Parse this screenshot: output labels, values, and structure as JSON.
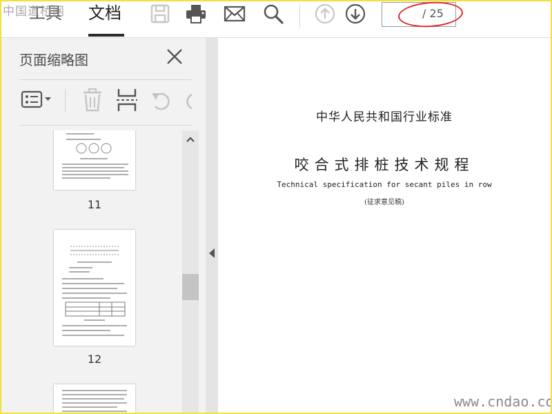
{
  "watermark_logo": "中国道桥网",
  "toolbar": {
    "tab_tools": "工具",
    "tab_document": "文档",
    "icons": [
      "save-icon",
      "print-icon",
      "mail-icon",
      "search-icon",
      "page-up-icon",
      "page-down-icon"
    ],
    "page_input_value": "",
    "page_total": "/ 25"
  },
  "sidebar": {
    "title": "页面缩略图",
    "tools": [
      "thumbnail-options-icon",
      "delete-icon",
      "crop-icon",
      "rotate-left-icon",
      "rotate-right-icon"
    ],
    "thumbnails": [
      {
        "label": "11"
      },
      {
        "label": "12"
      }
    ]
  },
  "document": {
    "line1": "中华人民共和国行业标准",
    "title": "咬合式排桩技术规程",
    "english_title": "Technical specification for secant piles in row",
    "note": "(征求意见稿)"
  },
  "site_watermark": "www.cndao.com",
  "colors": {
    "annotation": "#d92b2b",
    "frame_border": "#f2e13a",
    "sidebar_bg": "#f2f2f2"
  }
}
